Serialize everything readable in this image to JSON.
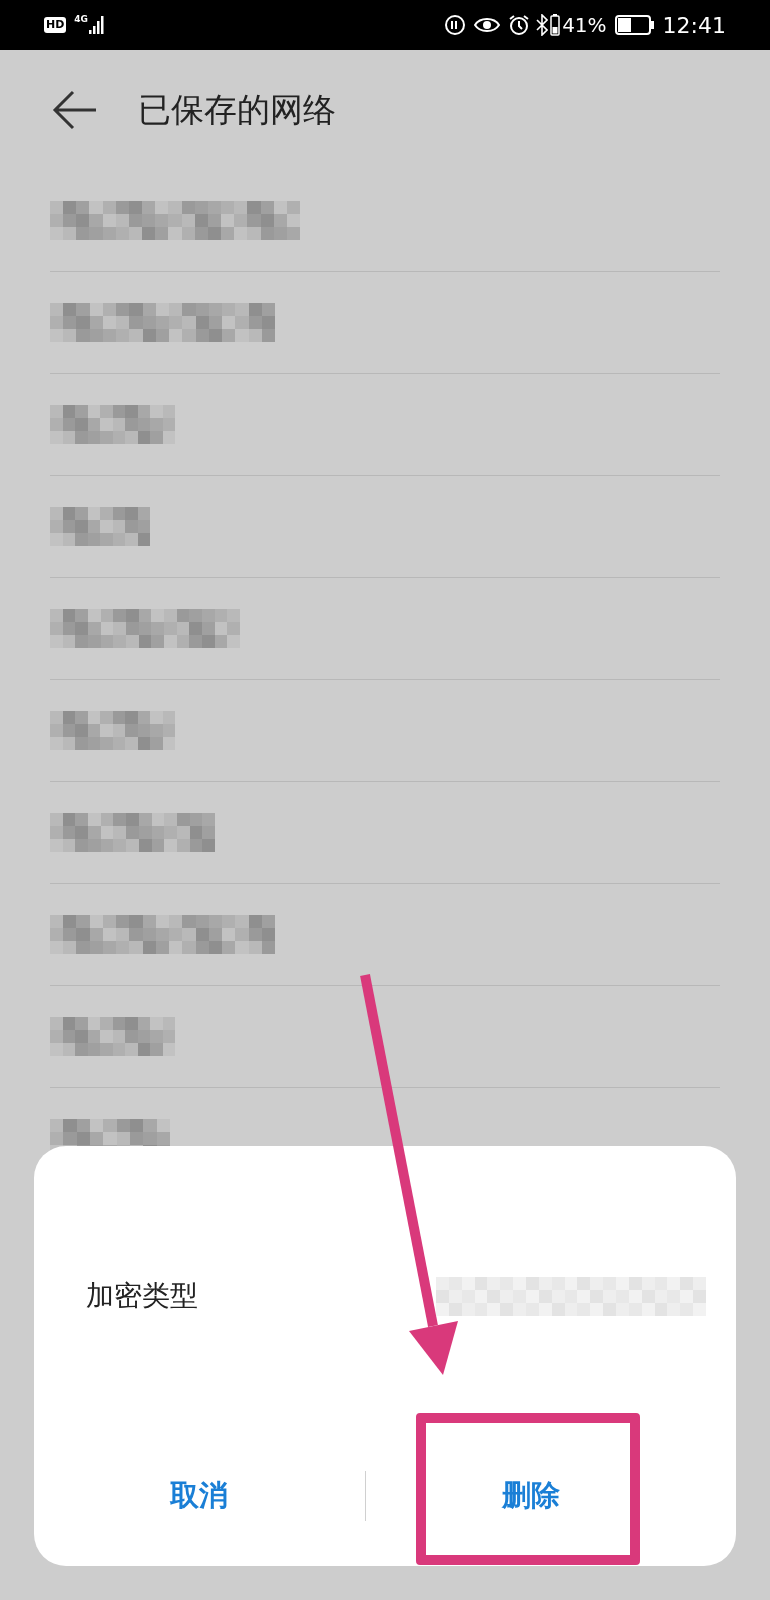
{
  "status_bar": {
    "hd_badge": "HD",
    "network_type": "4G",
    "battery": "41%",
    "time": "12:41"
  },
  "header": {
    "title": "已保存的网络"
  },
  "networks": [
    {
      "kind": "redacted"
    },
    {
      "kind": "redacted"
    },
    {
      "kind": "redacted"
    },
    {
      "kind": "redacted"
    },
    {
      "kind": "redacted"
    },
    {
      "kind": "redacted"
    },
    {
      "kind": "redacted"
    },
    {
      "kind": "redacted"
    },
    {
      "kind": "redacted"
    },
    {
      "kind": "redacted"
    }
  ],
  "dialog": {
    "rows": [
      {
        "label": "加密类型",
        "kind": "redacted_value"
      }
    ],
    "buttons": [
      {
        "label": "取消",
        "kind": "cancel",
        "highlighted": false
      },
      {
        "label": "删除",
        "kind": "delete",
        "highlighted": true
      }
    ]
  }
}
